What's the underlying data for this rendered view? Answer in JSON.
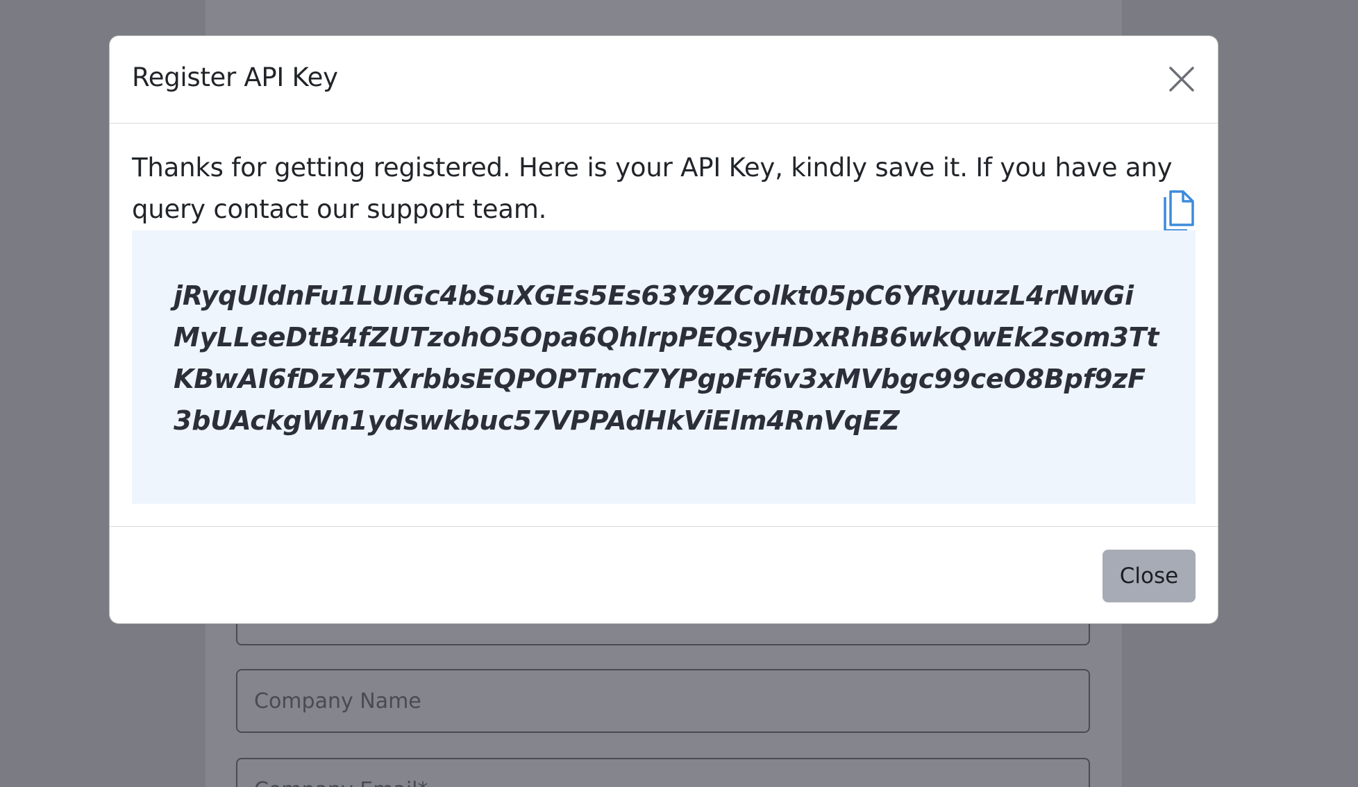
{
  "background_form": {
    "company_name_placeholder": "Company Name",
    "company_email_placeholder": "Company Email*"
  },
  "modal": {
    "title": "Register API Key",
    "message": "Thanks for getting registered. Here is your API Key, kindly save it. If you have any query contact our support team.",
    "api_key": "jRyqUldnFu1LUIGc4bSuXGEs5Es63Y9ZColkt05pC6YRyuuzL4rNwGiMyLLeeDtB4fZUTzohO5Opa6QhlrpPEQsyHDxRhB6wkQwEk2som3TtKBwAI6fDzY5TXrbbsEQPOPTmC7YPgpFf6v3xMVbgc99ceO8Bpf9zF3bUAckgWn1ydswkbuc57VPPAdHkViElm4RnVqEZ",
    "close_button_label": "Close"
  },
  "icons": {
    "close": "close-icon",
    "copy": "copy-icon"
  },
  "colors": {
    "overlay": "#7a7b83",
    "key_box": "#eef5fd",
    "copy_icon": "#3d8bdb",
    "close_button": "#a6abb5"
  }
}
